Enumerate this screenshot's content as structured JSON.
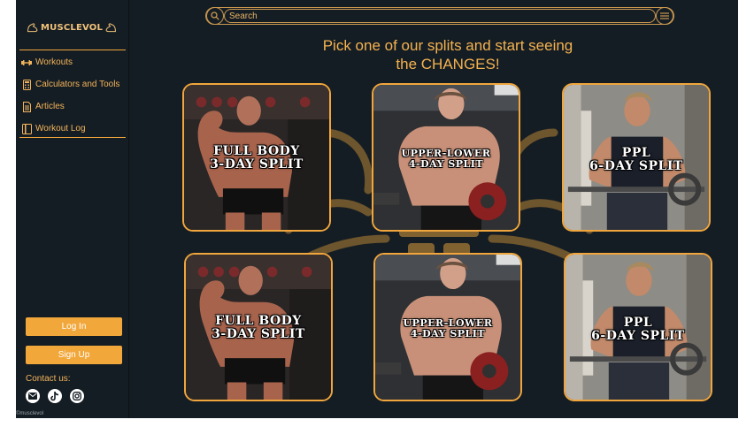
{
  "brand": {
    "name": "MUSCLEVOL"
  },
  "nav": {
    "items": [
      {
        "label": "Workouts",
        "icon": "dumbbell-icon"
      },
      {
        "label": "Calculators and Tools",
        "icon": "calculator-icon"
      },
      {
        "label": "Articles",
        "icon": "document-icon"
      },
      {
        "label": "Workout Log",
        "icon": "log-book-icon"
      }
    ]
  },
  "auth": {
    "login_label": "Log In",
    "signup_label": "Sign Up"
  },
  "contact": {
    "label": "Contact us:",
    "icons": [
      "email-icon",
      "tiktok-icon",
      "instagram-icon"
    ]
  },
  "search": {
    "placeholder": "Search"
  },
  "headline": {
    "line1": "Pick one of our splits and start seeing",
    "line2": "the CHANGES!"
  },
  "cards": [
    {
      "line1": "FULL BODY",
      "line2": "3-DAY SPLIT"
    },
    {
      "line1": "UPPER-LOWER",
      "line2": "4-DAY SPLIT"
    },
    {
      "line1": "PPL",
      "line2": "6-DAY SPLIT"
    },
    {
      "line1": "FULL BODY",
      "line2": "3-DAY SPLIT"
    },
    {
      "line1": "UPPER-LOWER",
      "line2": "4-DAY SPLIT"
    },
    {
      "line1": "PPL",
      "line2": "6-DAY SPLIT"
    }
  ],
  "footer": {
    "mark": "©musclevol"
  },
  "colors": {
    "background": "#151d24",
    "accent": "#f0a63c",
    "text_accent": "#f3b45a"
  }
}
